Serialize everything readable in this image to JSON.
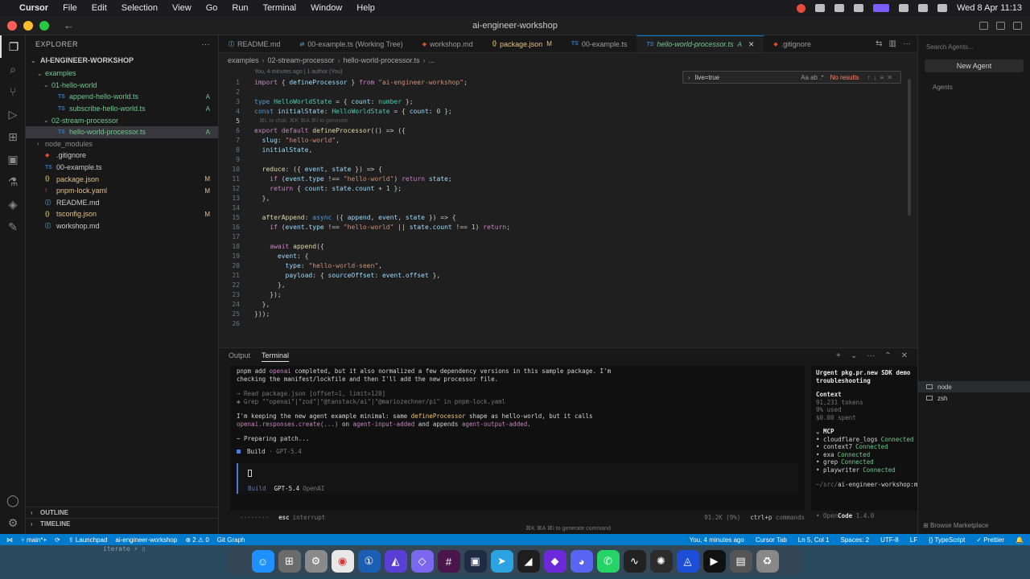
{
  "menubar": {
    "app": "Cursor",
    "items": [
      "File",
      "Edit",
      "Selection",
      "View",
      "Go",
      "Run",
      "Terminal",
      "Window",
      "Help"
    ],
    "clock": "Wed 8 Apr 11:13"
  },
  "window": {
    "title": "ai-engineer-workshop"
  },
  "sidebar": {
    "header": "EXPLORER",
    "root": "AI-ENGINEER-WORKSHOP",
    "items": [
      {
        "name": "examples",
        "depth": 1,
        "type": "folder",
        "open": true,
        "cls": "folder-green"
      },
      {
        "name": "01-hello-world",
        "depth": 2,
        "type": "folder",
        "open": true,
        "cls": "folder-green"
      },
      {
        "name": "append-hello-world.ts",
        "depth": 3,
        "type": "ts",
        "badge": "A",
        "cls": "added-name"
      },
      {
        "name": "subscribe-hello-world.ts",
        "depth": 3,
        "type": "ts",
        "badge": "A",
        "cls": "added-name"
      },
      {
        "name": "02-stream-processor",
        "depth": 2,
        "type": "folder",
        "open": true,
        "cls": "folder-green"
      },
      {
        "name": "hello-world-processor.ts",
        "depth": 3,
        "type": "ts",
        "badge": "A",
        "cls": "added-name selected"
      },
      {
        "name": "node_modules",
        "depth": 1,
        "type": "folder",
        "open": false,
        "cls": "dim"
      },
      {
        "name": ".gitignore",
        "depth": 1,
        "type": "git",
        "cls": ""
      },
      {
        "name": "00-example.ts",
        "depth": 1,
        "type": "ts",
        "cls": ""
      },
      {
        "name": "package.json",
        "depth": 1,
        "type": "json",
        "badge": "M",
        "cls": "mod-name"
      },
      {
        "name": "pnpm-lock.yaml",
        "depth": 1,
        "type": "yaml",
        "badge": "M",
        "cls": "mod-name"
      },
      {
        "name": "README.md",
        "depth": 1,
        "type": "md",
        "cls": ""
      },
      {
        "name": "tsconfig.json",
        "depth": 1,
        "type": "json",
        "badge": "M",
        "cls": "mod-name"
      },
      {
        "name": "workshop.md",
        "depth": 1,
        "type": "md",
        "cls": ""
      }
    ],
    "outline": "OUTLINE",
    "timeline": "TIMELINE"
  },
  "tabs": [
    {
      "label": "README.md",
      "icon": "ⓘ",
      "mark": "",
      "active": false
    },
    {
      "label": "00-example.ts (Working Tree)",
      "icon": "⇄",
      "mark": "",
      "active": false
    },
    {
      "label": "workshop.md",
      "icon": "◆",
      "mark": "",
      "active": false
    },
    {
      "label": "package.json",
      "icon": "{}",
      "mark": "M",
      "active": false
    },
    {
      "label": "00-example.ts",
      "icon": "TS",
      "mark": "",
      "active": false
    },
    {
      "label": "hello-world-processor.ts",
      "icon": "TS",
      "mark": "A",
      "active": true
    },
    {
      "label": ".gitignore",
      "icon": "◆",
      "mark": "",
      "active": false
    }
  ],
  "breadcrumb": [
    "examples",
    "02-stream-processor",
    "hello-world-processor.ts",
    "..."
  ],
  "find": {
    "query": "live=true",
    "opts": "Aa  ab  .*",
    "result": "No results"
  },
  "editor": {
    "blame": "You, 4 minutes ago | 1 author (You)",
    "ghost_hint": "⌘L to chat, ⌘K ⌘A ⌘I to generate",
    "lines": [
      [
        [
          "kw",
          "import"
        ],
        [
          "pl",
          " { "
        ],
        [
          "va",
          "defineProcessor"
        ],
        [
          "pl",
          " } "
        ],
        [
          "kw",
          "from"
        ],
        [
          "str",
          " \"ai-engineer-workshop\""
        ],
        [
          "pl",
          ";"
        ]
      ],
      [],
      [
        [
          "kw2",
          "type"
        ],
        [
          "ty",
          " HelloWorldState"
        ],
        [
          "pl",
          " = { "
        ],
        [
          "va",
          "count"
        ],
        [
          "pl",
          ": "
        ],
        [
          "ty",
          "number"
        ],
        [
          "pl",
          " };"
        ]
      ],
      [
        [
          "kw2",
          "const"
        ],
        [
          "va",
          " initialState"
        ],
        [
          "pl",
          ": "
        ],
        [
          "ty",
          "HelloWorldState"
        ],
        [
          "pl",
          " = { "
        ],
        [
          "va",
          "count"
        ],
        [
          "pl",
          ": "
        ],
        [
          "nu",
          "0"
        ],
        [
          "pl",
          " };"
        ]
      ],
      [],
      [
        [
          "kw",
          "export"
        ],
        [
          "kw",
          " default"
        ],
        [
          "fn",
          " defineProcessor"
        ],
        [
          "pl",
          "(() => ({"
        ]
      ],
      [
        [
          "va",
          "  slug"
        ],
        [
          "pl",
          ": "
        ],
        [
          "str",
          "\"hello-world\""
        ],
        [
          "pl",
          ","
        ]
      ],
      [
        [
          "va",
          "  initialState"
        ],
        [
          "pl",
          ","
        ]
      ],
      [],
      [
        [
          "fn",
          "  reduce"
        ],
        [
          "pl",
          ": ({ "
        ],
        [
          "va",
          "event"
        ],
        [
          "pl",
          ", "
        ],
        [
          "va",
          "state"
        ],
        [
          "pl",
          " }) => {"
        ]
      ],
      [
        [
          "kw",
          "    if"
        ],
        [
          "pl",
          " ("
        ],
        [
          "va",
          "event"
        ],
        [
          "pl",
          "."
        ],
        [
          "va",
          "type"
        ],
        [
          "pl",
          " !== "
        ],
        [
          "str",
          "\"hello-world\""
        ],
        [
          "pl",
          ") "
        ],
        [
          "kw",
          "return"
        ],
        [
          "va",
          " state"
        ],
        [
          "pl",
          ";"
        ]
      ],
      [
        [
          "kw",
          "    return"
        ],
        [
          "pl",
          " { "
        ],
        [
          "va",
          "count"
        ],
        [
          "pl",
          ": "
        ],
        [
          "va",
          "state"
        ],
        [
          "pl",
          "."
        ],
        [
          "va",
          "count"
        ],
        [
          "pl",
          " + "
        ],
        [
          "nu",
          "1"
        ],
        [
          "pl",
          " };"
        ]
      ],
      [
        [
          "pl",
          "  },"
        ]
      ],
      [],
      [
        [
          "fn",
          "  afterAppend"
        ],
        [
          "pl",
          ": "
        ],
        [
          "kw2",
          "async"
        ],
        [
          "pl",
          " ({ "
        ],
        [
          "va",
          "append"
        ],
        [
          "pl",
          ", "
        ],
        [
          "va",
          "event"
        ],
        [
          "pl",
          ", "
        ],
        [
          "va",
          "state"
        ],
        [
          "pl",
          " }) => {"
        ]
      ],
      [
        [
          "kw",
          "    if"
        ],
        [
          "pl",
          " ("
        ],
        [
          "va",
          "event"
        ],
        [
          "pl",
          "."
        ],
        [
          "va",
          "type"
        ],
        [
          "pl",
          " !== "
        ],
        [
          "str",
          "\"hello-world\""
        ],
        [
          "pl",
          " || "
        ],
        [
          "va",
          "state"
        ],
        [
          "pl",
          "."
        ],
        [
          "va",
          "count"
        ],
        [
          "pl",
          " !== "
        ],
        [
          "nu",
          "1"
        ],
        [
          "pl",
          ") "
        ],
        [
          "kw",
          "return"
        ],
        [
          "pl",
          ";"
        ]
      ],
      [],
      [
        [
          "kw",
          "    await"
        ],
        [
          "fn",
          " append"
        ],
        [
          "pl",
          "({"
        ]
      ],
      [
        [
          "va",
          "      event"
        ],
        [
          "pl",
          ": {"
        ]
      ],
      [
        [
          "va",
          "        type"
        ],
        [
          "pl",
          ": "
        ],
        [
          "str",
          "\"hello-world-seen\""
        ],
        [
          "pl",
          ","
        ]
      ],
      [
        [
          "va",
          "        payload"
        ],
        [
          "pl",
          ": { "
        ],
        [
          "va",
          "sourceOffset"
        ],
        [
          "pl",
          ": "
        ],
        [
          "va",
          "event"
        ],
        [
          "pl",
          "."
        ],
        [
          "va",
          "offset"
        ],
        [
          "pl",
          " },"
        ]
      ],
      [
        [
          "pl",
          "      },"
        ]
      ],
      [
        [
          "pl",
          "    });"
        ]
      ],
      [
        [
          "pl",
          "  },"
        ]
      ],
      [
        [
          "pl",
          "}));"
        ]
      ],
      []
    ]
  },
  "panel": {
    "tabs": [
      "Output",
      "Terminal"
    ],
    "terminal": {
      "l1a": "pnpm add ",
      "l1b": "openai",
      "l1c": " completed, but it also normalized a few dependency versions in this sample package. I'm",
      "l2": "checking the manifest/lockfile and then I'll add the new processor file.",
      "l3": "→ Read package.json [offset=1, limit=120]",
      "l4": "✱ Grep \"\"openai\"|\"zod\"|\"@tanstack/ai\"|\"@mariozechner/pi\" in pnpm-lock.yaml",
      "l5a": "I'm keeping the new agent example minimal: same ",
      "l5b": "defineProcessor",
      "l5c": " shape as hello-world, but it calls",
      "l6a": "openai.responses.create(...)",
      "l6b": " on ",
      "l6c": "agent-input-added",
      "l6d": " and appends ",
      "l6e": "agent-output-added",
      "l6f": ".",
      "l7": "~ Preparing patch...",
      "build": "Build",
      "build_model": "· GPT-5.4",
      "meta_mode": "Build",
      "meta_model": "GPT-5.4",
      "meta_provider": "OpenAI",
      "status_dots": "········",
      "status_esc": "esc",
      "status_int": "interrupt",
      "status_tokens": "91.2K (9%)",
      "status_ctrl": "ctrl+p",
      "status_cmd": "commands"
    },
    "side": {
      "title": "Urgent pkg.pr.new SDK demo troubleshooting",
      "context_label": "Context",
      "tokens": "91,231 tokens",
      "used": "9% used",
      "spent": "$0.00 spent",
      "mcp_label": "MCP",
      "mcp": [
        {
          "name": "cloudflare_logs",
          "status": "Connected"
        },
        {
          "name": "context7",
          "status": "Connected"
        },
        {
          "name": "exa",
          "status": "Connected"
        },
        {
          "name": "grep",
          "status": "Connected"
        },
        {
          "name": "playwriter",
          "status": "Connected"
        }
      ],
      "path_a": "~/src/",
      "path_b": "ai-engineer-workshop:main",
      "brand_a": "Open",
      "brand_b": "Code",
      "version": "1.4.0"
    },
    "hint": "⌘K ⌘A ⌘I to generate command"
  },
  "agents": {
    "search_placeholder": "Search Agents...",
    "new_agent": "New Agent",
    "label": "Agents",
    "terminals": [
      "node",
      "zsh"
    ],
    "browse": "Browse Marketplace"
  },
  "statusbar": {
    "branch": "main*+",
    "launchpad": "Launchpad",
    "repo": "ai-engineer-workshop",
    "problems": "⊗ 2 ⚠ 0",
    "git_graph": "Git Graph",
    "blame": "You, 4 minutes ago",
    "cursor_tab": "Cursor Tab",
    "position": "Ln 5, Col 1",
    "spaces": "Spaces: 2",
    "encoding": "UTF-8",
    "eol": "LF",
    "lang": "{} TypeScript",
    "prettier": "✓ Prettier"
  },
  "ghost_terminal": "iterate ⚡ ▯",
  "colors": {
    "accent": "#007acc",
    "added": "#73c991",
    "modified": "#e2c08d"
  }
}
